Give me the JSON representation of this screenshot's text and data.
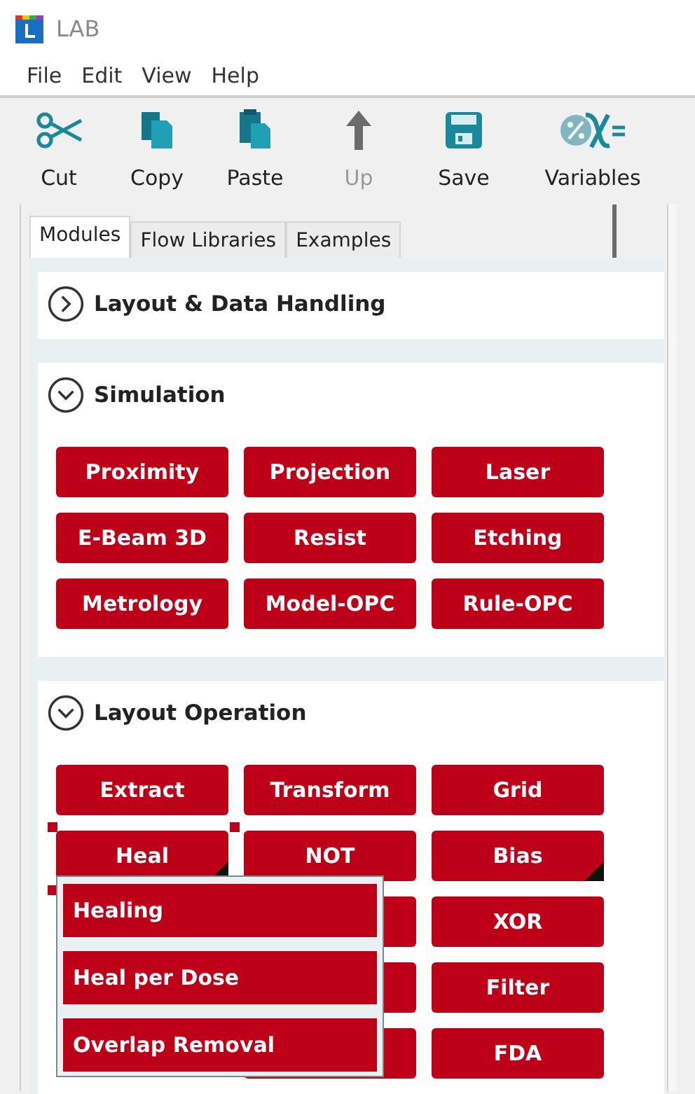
{
  "window": {
    "title": "LAB"
  },
  "menu": [
    "File",
    "Edit",
    "View",
    "Help"
  ],
  "toolbar": [
    {
      "kind": "cut",
      "label": "Cut",
      "disabled": false
    },
    {
      "kind": "copy",
      "label": "Copy",
      "disabled": false
    },
    {
      "kind": "paste",
      "label": "Paste",
      "disabled": false
    },
    {
      "kind": "up",
      "label": "Up",
      "disabled": true
    },
    {
      "kind": "save",
      "label": "Save",
      "disabled": false
    },
    {
      "kind": "variables",
      "label": "Variables",
      "disabled": false
    }
  ],
  "tabs": [
    {
      "label": "Modules",
      "selected": true
    },
    {
      "label": "Flow Libraries",
      "selected": false
    },
    {
      "label": "Examples",
      "selected": false
    }
  ],
  "sections": [
    {
      "title": "Layout & Data Handling",
      "expanded": false
    },
    {
      "title": "Simulation",
      "expanded": true,
      "rows": [
        [
          {
            "label": "Proximity",
            "has_menu": false,
            "selected": false
          },
          {
            "label": "Projection",
            "has_menu": false,
            "selected": false
          },
          {
            "label": "Laser",
            "has_menu": false,
            "selected": false
          }
        ],
        [
          {
            "label": "E-Beam 3D",
            "has_menu": false,
            "selected": false
          },
          {
            "label": "Resist",
            "has_menu": false,
            "selected": false
          },
          {
            "label": "Etching",
            "has_menu": false,
            "selected": false
          }
        ],
        [
          {
            "label": "Metrology",
            "has_menu": false,
            "selected": false
          },
          {
            "label": "Model-OPC",
            "has_menu": false,
            "selected": false
          },
          {
            "label": "Rule-OPC",
            "has_menu": false,
            "selected": false
          }
        ]
      ]
    },
    {
      "title": "Layout Operation",
      "expanded": true,
      "rows": [
        [
          {
            "label": "Extract",
            "has_menu": false,
            "selected": false
          },
          {
            "label": "Transform",
            "has_menu": false,
            "selected": false
          },
          {
            "label": "Grid",
            "has_menu": false,
            "selected": false
          }
        ],
        [
          {
            "label": "Heal",
            "has_menu": true,
            "selected": true
          },
          {
            "label": "NOT",
            "has_menu": false,
            "selected": false
          },
          {
            "label": "Bias",
            "has_menu": true,
            "selected": false
          }
        ],
        [
          null,
          {
            "has_menu": false,
            "selected": false
          },
          {
            "label": "XOR",
            "has_menu": false,
            "selected": false
          }
        ],
        [
          null,
          {
            "has_menu": false,
            "selected": false
          },
          {
            "label": "Filter",
            "has_menu": false,
            "selected": false
          }
        ],
        [
          null,
          {
            "has_menu": false,
            "selected": false
          },
          {
            "label": "FDA",
            "has_menu": false,
            "selected": false
          }
        ]
      ]
    }
  ],
  "popup_menu": [
    "Healing",
    "Heal per Dose",
    "Overlap Removal"
  ]
}
